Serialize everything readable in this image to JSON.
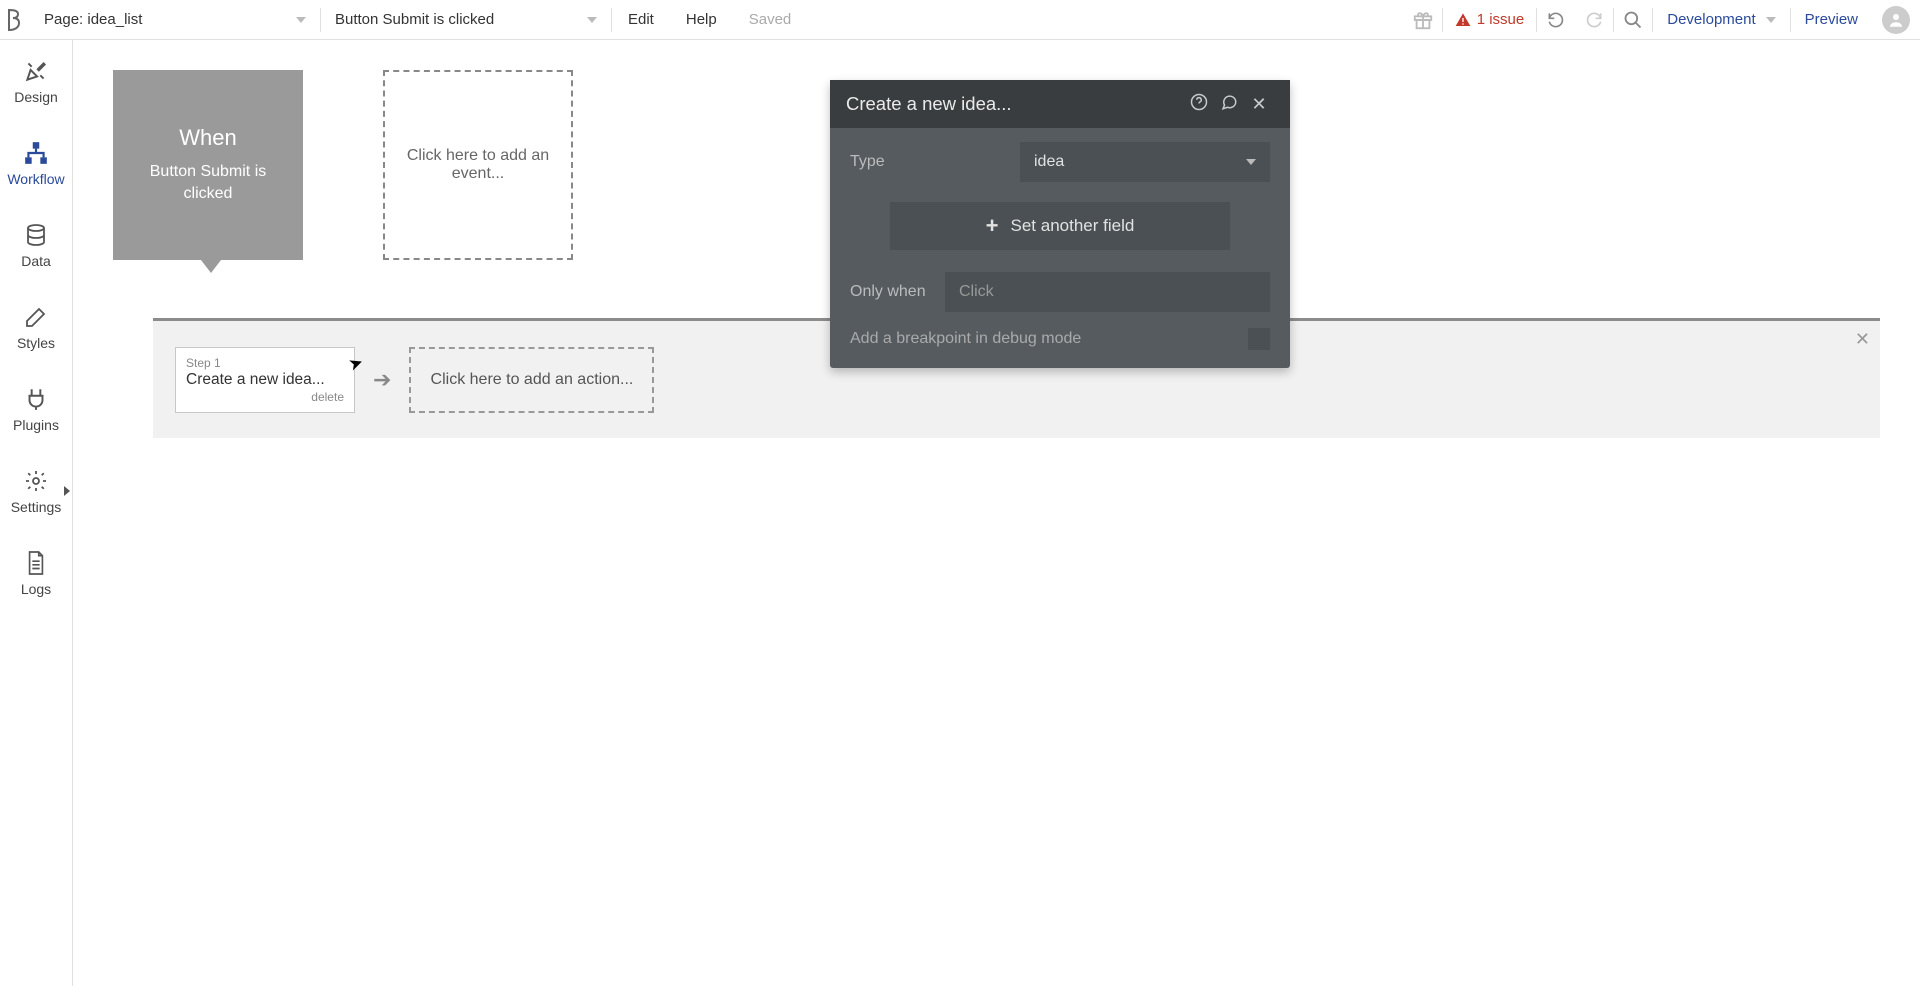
{
  "topbar": {
    "page_label_prefix": "Page: ",
    "page_name": "idea_list",
    "event_selected": "Button Submit is clicked",
    "edit": "Edit",
    "help": "Help",
    "saved": "Saved",
    "issues": "1 issue",
    "dev_mode": "Development",
    "preview": "Preview"
  },
  "nav": {
    "design": "Design",
    "workflow": "Workflow",
    "data": "Data",
    "styles": "Styles",
    "plugins": "Plugins",
    "settings": "Settings",
    "logs": "Logs"
  },
  "workflow": {
    "event_when": "When",
    "event_trigger": "Button Submit is clicked",
    "add_event": "Click here to add an event...",
    "step_label": "Step 1",
    "step_title": "Create a new idea...",
    "step_delete": "delete",
    "add_action": "Click here to add an action..."
  },
  "panel": {
    "title": "Create a new idea...",
    "type_label": "Type",
    "type_value": "idea",
    "set_another": "Set another field",
    "only_when_label": "Only when",
    "only_when_placeholder": "Click",
    "breakpoint": "Add a breakpoint in debug mode"
  }
}
